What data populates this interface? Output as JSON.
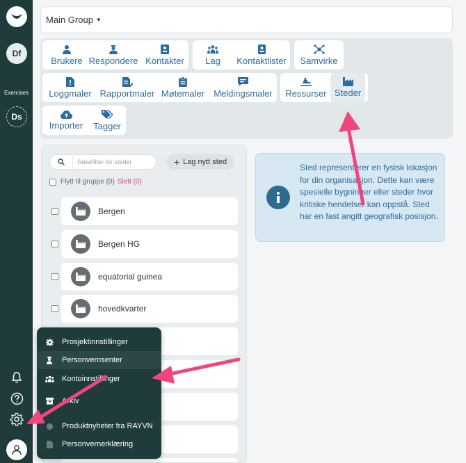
{
  "sidebar": {
    "user_initials": "Df",
    "section_label": "Exercises",
    "exercise_initials": "Ds"
  },
  "group_selector": {
    "label": "Main Group"
  },
  "nav": {
    "brukere": "Brukere",
    "respondere": "Respondere",
    "kontakter": "Kontakter",
    "lag": "Lag",
    "kontaktlister": "Kontaktlister",
    "samvirke": "Samvirke",
    "loggmaler": "Loggmaler",
    "rapportmaler": "Rapportmaler",
    "motemaler": "Møtemaler",
    "meldingsmaler": "Meldingsmaler",
    "ressurser": "Ressurser",
    "steder": "Steder",
    "importer": "Importer",
    "tagger": "Tagger"
  },
  "list": {
    "search_placeholder": "Søkefilter for steder",
    "add_label": "Lag nytt sted",
    "move_label": "Flytt til gruppe (0)",
    "delete_label": "Slett (0)",
    "items": [
      "Bergen",
      "Bergen HG",
      "equatorial guinea",
      "hovedkvarter"
    ]
  },
  "info": {
    "text": "Sted representerer en fysisk lokasjon for din organisasjon. Dette kan være spesielle bygninger eller steder hvor kritiske hendelser kan oppstå. Sted har en fast angitt geografisk posisjon."
  },
  "menu": {
    "items": [
      "Prosjektinnstillinger",
      "Personvernsenter",
      "Kontoinnstillinger",
      "Arkiv",
      "Produktnyheter fra RAYVN",
      "Personvernerklæring"
    ]
  },
  "colors": {
    "accent": "#2d6c9e",
    "sidebar": "#1f3b3c",
    "annotation_arrow": "#f0467e"
  }
}
